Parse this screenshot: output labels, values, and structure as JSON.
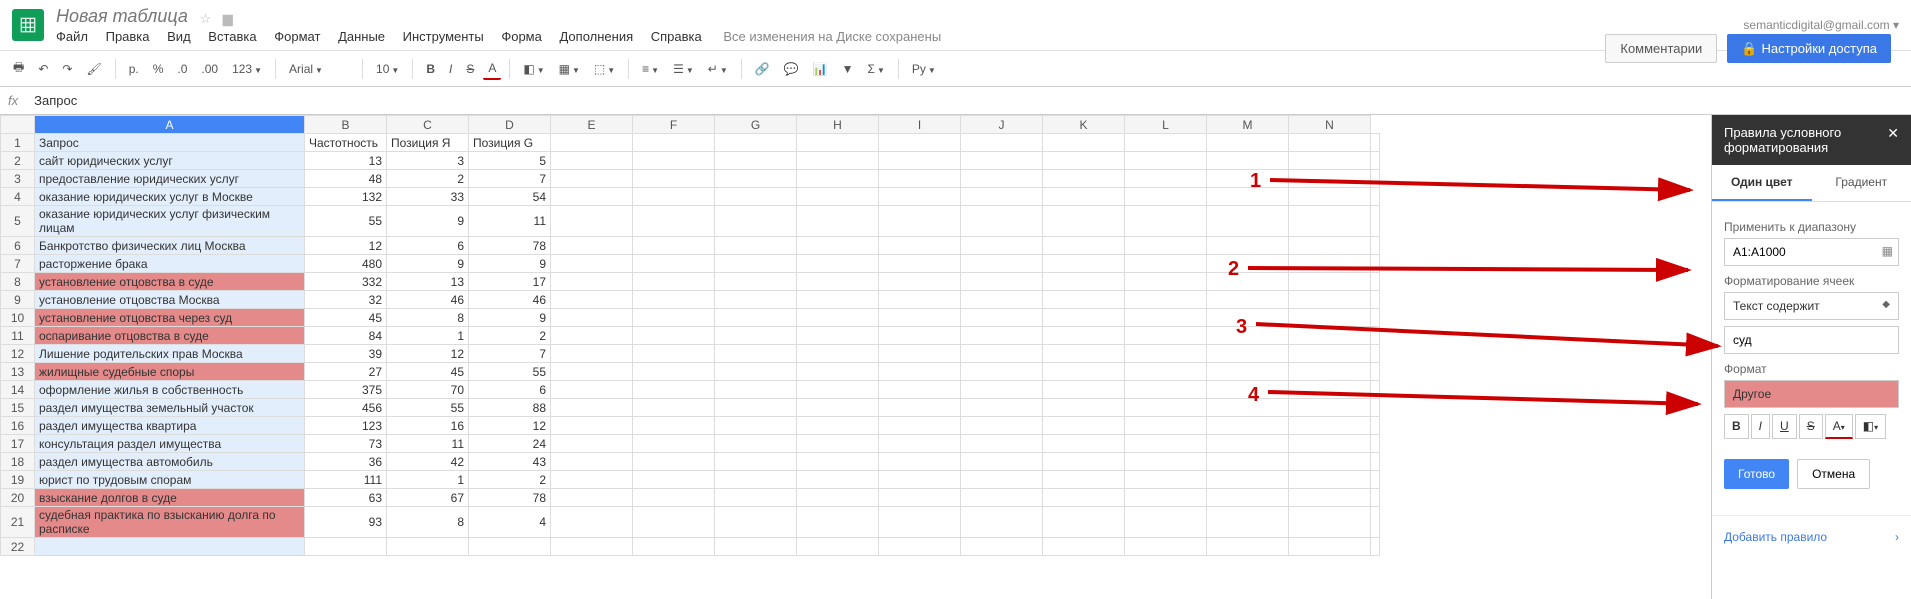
{
  "header": {
    "doc_title": "Новая таблица",
    "user_email": "semanticdigital@gmail.com ▾",
    "comments_btn": "Комментарии",
    "share_btn": "Настройки доступа"
  },
  "menu": {
    "file": "Файл",
    "edit": "Правка",
    "view": "Вид",
    "insert": "Вставка",
    "format": "Формат",
    "data": "Данные",
    "tools": "Инструменты",
    "form": "Форма",
    "addons": "Дополнения",
    "help": "Справка",
    "save_status": "Все изменения на Диске сохранены"
  },
  "toolbar": {
    "currency": "р.",
    "percent": "%",
    "dec_dec": ".0",
    "dec_inc": ".00",
    "more_fmt": "123",
    "font": "Arial",
    "font_size": "10",
    "bold": "B",
    "italic": "I",
    "strike": "S",
    "text_color": "A",
    "ru": "Ру"
  },
  "fx": {
    "label": "fx",
    "value": "Запрос"
  },
  "columns": [
    "",
    "A",
    "B",
    "C",
    "D",
    "E",
    "F",
    "G",
    "H",
    "I",
    "J",
    "K",
    "L",
    "M",
    "N"
  ],
  "rows": [
    {
      "n": 1,
      "a": "Запрос",
      "b": "Частотность",
      "c": "Позиция Я",
      "d": "Позиция G",
      "hl": false,
      "hdr": true
    },
    {
      "n": 2,
      "a": "сайт юридических услуг",
      "b": 13,
      "c": 3,
      "d": 5,
      "hl": false
    },
    {
      "n": 3,
      "a": "предоставление юридических услуг",
      "b": 48,
      "c": 2,
      "d": 7,
      "hl": false
    },
    {
      "n": 4,
      "a": "оказание юридических услуг в Москве",
      "b": 132,
      "c": 33,
      "d": 54,
      "hl": false
    },
    {
      "n": 5,
      "a": "оказание юридических услуг физическим лицам",
      "b": 55,
      "c": 9,
      "d": 11,
      "hl": false
    },
    {
      "n": 6,
      "a": "Банкротство физических лиц Москва",
      "b": 12,
      "c": 6,
      "d": 78,
      "hl": false
    },
    {
      "n": 7,
      "a": "расторжение брака",
      "b": 480,
      "c": 9,
      "d": 9,
      "hl": false
    },
    {
      "n": 8,
      "a": "установление отцовства в суде",
      "b": 332,
      "c": 13,
      "d": 17,
      "hl": true
    },
    {
      "n": 9,
      "a": "установление отцовства Москва",
      "b": 32,
      "c": 46,
      "d": 46,
      "hl": false
    },
    {
      "n": 10,
      "a": "установление отцовства через суд",
      "b": 45,
      "c": 8,
      "d": 9,
      "hl": true
    },
    {
      "n": 11,
      "a": "оспаривание отцовства в суде",
      "b": 84,
      "c": 1,
      "d": 2,
      "hl": true
    },
    {
      "n": 12,
      "a": "Лишение родительских прав Москва",
      "b": 39,
      "c": 12,
      "d": 7,
      "hl": false
    },
    {
      "n": 13,
      "a": "жилищные судебные споры",
      "b": 27,
      "c": 45,
      "d": 55,
      "hl": true
    },
    {
      "n": 14,
      "a": "оформление жилья в собственность",
      "b": 375,
      "c": 70,
      "d": 6,
      "hl": false
    },
    {
      "n": 15,
      "a": "раздел имущества земельный участок",
      "b": 456,
      "c": 55,
      "d": 88,
      "hl": false
    },
    {
      "n": 16,
      "a": "раздел имущества квартира",
      "b": 123,
      "c": 16,
      "d": 12,
      "hl": false
    },
    {
      "n": 17,
      "a": "консультация раздел имущества",
      "b": 73,
      "c": 11,
      "d": 24,
      "hl": false
    },
    {
      "n": 18,
      "a": "раздел имущества автомобиль",
      "b": 36,
      "c": 42,
      "d": 43,
      "hl": false
    },
    {
      "n": 19,
      "a": "юрист по трудовым спорам",
      "b": 111,
      "c": 1,
      "d": 2,
      "hl": false
    },
    {
      "n": 20,
      "a": "взыскание долгов в суде",
      "b": 63,
      "c": 67,
      "d": 78,
      "hl": true
    },
    {
      "n": 21,
      "a": "судебная практика по взысканию долга по расписке",
      "b": 93,
      "c": 8,
      "d": 4,
      "hl": true
    },
    {
      "n": 22,
      "a": "",
      "b": "",
      "c": "",
      "d": "",
      "hl": false
    }
  ],
  "panel": {
    "title": "Правила условного форматирования",
    "tab_single": "Один цвет",
    "tab_gradient": "Градиент",
    "range_label": "Применить к диапазону",
    "range_value": "A1:A1000",
    "condition_label": "Форматирование ячеек",
    "condition_value": "Текст содержит",
    "condition_input": "суд",
    "format_label": "Формат",
    "format_value": "Другое",
    "done": "Готово",
    "cancel": "Отмена",
    "add_rule": "Добавить правило"
  },
  "annotations": {
    "a1": "1",
    "a2": "2",
    "a3": "3",
    "a4": "4"
  }
}
